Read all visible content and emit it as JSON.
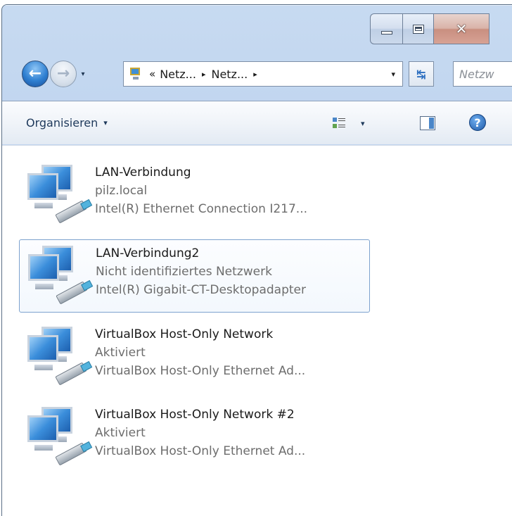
{
  "window": {
    "caption_buttons": {
      "minimize": "minimize",
      "maximize": "maximize",
      "close": "close"
    }
  },
  "nav": {
    "back_glyph": "←",
    "forward_glyph": "→",
    "history_dropdown": "▾"
  },
  "address": {
    "overflow": "«",
    "crumbs": [
      "Netz...",
      "Netz..."
    ],
    "separator": "▸",
    "dropdown": "▾"
  },
  "refresh_glyph": "↹",
  "search": {
    "placeholder": "Netzw"
  },
  "toolbar": {
    "organize_label": "Organisieren",
    "organize_caret": "▾",
    "views_caret": "▾",
    "help_label": "?"
  },
  "connections": [
    {
      "name": "LAN-Verbindung",
      "status": "pilz.local",
      "device": "Intel(R) Ethernet Connection I217..."
    },
    {
      "name": "LAN-Verbindung2",
      "status": "Nicht identifiziertes Netzwerk",
      "device": "Intel(R) Gigabit-CT-Desktopadapter"
    },
    {
      "name": "VirtualBox Host-Only Network",
      "status": "Aktiviert",
      "device": "VirtualBox Host-Only Ethernet Ad..."
    },
    {
      "name": "VirtualBox Host-Only Network #2",
      "status": "Aktiviert",
      "device": "VirtualBox Host-Only Ethernet Ad..."
    }
  ],
  "colors": {
    "accent": "#2e7fd1",
    "selection_border": "#7da2ce",
    "chrome": "#bcd2ee"
  }
}
